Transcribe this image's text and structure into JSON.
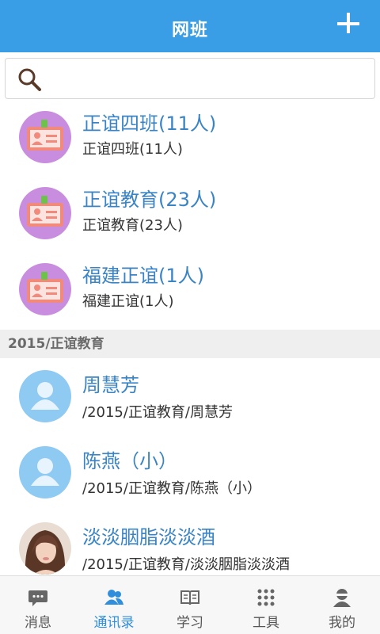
{
  "header": {
    "title": "网班",
    "add_icon": "plus-icon"
  },
  "search": {
    "placeholder": "",
    "icon": "search-icon"
  },
  "groups": [
    {
      "name": "正谊四班(11人)",
      "subtitle": "正谊四班(11人)",
      "icon": "id-card-icon"
    },
    {
      "name": "正谊教育(23人)",
      "subtitle": "正谊教育(23人)",
      "icon": "id-card-icon"
    },
    {
      "name": "福建正谊(1人)",
      "subtitle": "福建正谊(1人)",
      "icon": "id-card-icon"
    }
  ],
  "section": {
    "label": "2015/正谊教育"
  },
  "contacts": [
    {
      "name": "周慧芳",
      "path": "/2015/正谊教育/周慧芳",
      "avatar": "default-person-icon"
    },
    {
      "name": "陈燕（小）",
      "path": "/2015/正谊教育/陈燕（小）",
      "avatar": "default-person-icon"
    },
    {
      "name": "淡淡胭脂淡淡酒",
      "path": "/2015/正谊教育/淡淡胭脂淡淡酒",
      "avatar": "photo"
    }
  ],
  "tabs": [
    {
      "label": "消息",
      "icon": "chat-icon",
      "active": false
    },
    {
      "label": "通讯录",
      "icon": "contacts-icon",
      "active": true
    },
    {
      "label": "学习",
      "icon": "book-icon",
      "active": false
    },
    {
      "label": "工具",
      "icon": "grid-icon",
      "active": false
    },
    {
      "label": "我的",
      "icon": "profile-icon",
      "active": false
    }
  ],
  "colors": {
    "primary": "#3a9ee6",
    "name_text": "#3a84c6",
    "group_avatar": "#c98de0",
    "person_avatar": "#8fcaf3",
    "active_tab": "#2f8fdc"
  }
}
